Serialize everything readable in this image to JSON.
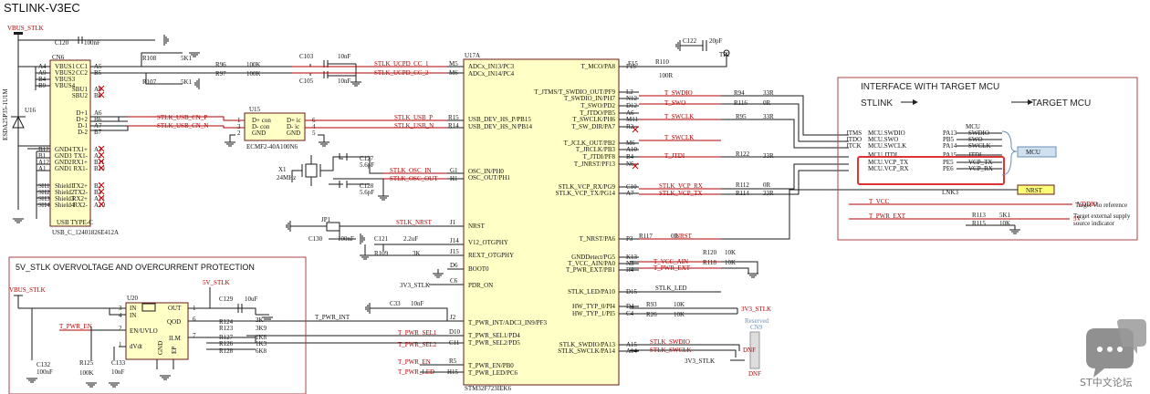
{
  "title": "STLINK-V3EC",
  "power": {
    "vbus_stlk": "VBUS_STLK",
    "v5_stlk": "5V_STLK",
    "v3v3_stlk": "3V3_STLK",
    "vddio": "VDDIO",
    "v5": "5V"
  },
  "usb_connector": {
    "ref": "CN6",
    "part": "USB_C_12401826E412A",
    "type": "USB TYPE-C",
    "left_pins": [
      {
        "num": "A4",
        "name": "VBUS1"
      },
      {
        "num": "A9",
        "name": "VBUS2"
      },
      {
        "num": "B4",
        "name": "VBUS3"
      },
      {
        "num": "B9",
        "name": "VBUS4"
      },
      {
        "num": "B12",
        "name": "GND4"
      },
      {
        "num": "B1",
        "name": "GND3"
      },
      {
        "num": "A12",
        "name": "GND2"
      },
      {
        "num": "A1",
        "name": "GND1"
      },
      {
        "num": "SH1",
        "name": "Shield1"
      },
      {
        "num": "SH2",
        "name": "Shield2"
      },
      {
        "num": "SH3",
        "name": "Shield3"
      },
      {
        "num": "SH4",
        "name": "Shield4"
      }
    ],
    "right_pins": [
      {
        "num": "A5",
        "name": "CC1"
      },
      {
        "num": "B5",
        "name": "CC2"
      },
      {
        "num": "A8",
        "name": "SBU1"
      },
      {
        "num": "B8",
        "name": "SBU2"
      },
      {
        "num": "A6",
        "name": "D+1"
      },
      {
        "num": "B6",
        "name": "D+2"
      },
      {
        "num": "A7",
        "name": "D-1"
      },
      {
        "num": "B7",
        "name": "D-2"
      },
      {
        "num": "A3",
        "name": "TX1+"
      },
      {
        "num": "A2",
        "name": "TX1-"
      },
      {
        "num": "B11",
        "name": "RX1+"
      },
      {
        "num": "B10",
        "name": "RX1-"
      },
      {
        "num": "B2",
        "name": "TX2+"
      },
      {
        "num": "B3",
        "name": "TX2-"
      },
      {
        "num": "A11",
        "name": "RX2+"
      },
      {
        "num": "A10",
        "name": "RX2-"
      }
    ]
  },
  "esd": {
    "ref": "U16",
    "part": "ESDA25P35-1U1M"
  },
  "usb_esd": {
    "ref": "U15",
    "part": "ECMF2-40A100N6",
    "pins": [
      "D+ con",
      "D- con",
      "GND",
      "D+ ic",
      "D- ic",
      "GND"
    ],
    "nums": [
      "1",
      "3",
      "2",
      "6",
      "4",
      "5"
    ]
  },
  "passives": {
    "c120": "C120",
    "c120v": "100nF",
    "r108": "R108",
    "r108v": "5K1",
    "r107": "R107",
    "r107v": "5K1",
    "r96": "R96",
    "r96v": "100K",
    "r97": "R97",
    "r97v": "100K",
    "c103": "C103",
    "c103v": "10nF",
    "c105": "C105",
    "c105v": "10nF",
    "c127": "C127",
    "c127v": "5.6pF",
    "c128": "C128",
    "c128v": "5.6pF",
    "x1": "X1",
    "x1v": "24MHz",
    "jp1": "JP1",
    "c130": "C130",
    "c130v": "100nF",
    "c121": "C121",
    "c121v": "2.2uF",
    "r109": "R109",
    "r109v": "3K",
    "c33": "C33",
    "c33v": "10nF",
    "c122": "C122",
    "c122v": "20pF",
    "tp2": "TP2",
    "r110": "R110",
    "r110v": "100R",
    "r94": "R94",
    "r94v": "33R",
    "r116": "R116",
    "r116v": "0R",
    "r95": "R95",
    "r95v": "33R",
    "r122": "R122",
    "r122v": "33R",
    "r112": "R112",
    "r112v": "0R",
    "r114": "R114",
    "r114v": "33R",
    "r117": "R117",
    "r117v": "0R",
    "r120": "R120",
    "r120v": "10K",
    "r118": "R118",
    "r118v": "10K",
    "r93": "R93",
    "r93v": "10K",
    "r26": "R26",
    "r26v": "10K",
    "r113": "R113",
    "r113v": "5K1",
    "r115": "R115",
    "r115v": "10K",
    "cn9": "CN9",
    "cn9_note": "Reserved",
    "dnf": "DNF"
  },
  "nets": {
    "ucpd_cc1": "STLK_UCPD_CC_1",
    "ucpd_cc2": "STLK_UCPD_CC_2",
    "usb_cn_p": "STLK_USB_CN_P",
    "usb_cn_n": "STLK_USB_CN_N",
    "usb_p": "STLK_USB_P",
    "usb_n": "STLK_USB_N",
    "osc_in": "STLK_OSC_IN",
    "osc_out": "STLK_OSC_OUT",
    "nrst": "STLK_NRST",
    "t_swdio": "T_SWDIO",
    "t_swo": "T_SWO",
    "t_swclk": "T_SWCLK",
    "t_jtdi": "T_JTDI",
    "t_vcp_rx": "T_VCP_RX",
    "t_vcp_tx": "T_VCP_TX",
    "stlk_vcp_rx": "STLK_VCP_RX",
    "stlk_vcp_tx": "STLK_VCP_TX",
    "nrst_out": "NRST",
    "t_vcc_ain": "T_VCC_AIN",
    "t_pwr_ext": "T_PWR_EXT",
    "t_vcc": "T_VCC",
    "stlk_led": "STLK_LED",
    "stlk_swdio": "STLK_SWDIO",
    "stlk_swclk": "STLK_SWCLK",
    "t_pwr_int": "T_PWR_INT",
    "t_pwr_en": "T_PWR_EN",
    "t_pwr_sel1": "T_PWR_SEL1",
    "t_pwr_sel2": "T_PWR_SEL2",
    "t_pwr_led": "T_PWR_LED"
  },
  "mcu": {
    "ref": "U17A",
    "part": "STM32F723IEK6",
    "left_pins": [
      {
        "num": "M5",
        "name": "ADCx_IN13/PC3"
      },
      {
        "num": "M6",
        "name": "ADCx_IN14/PC4"
      },
      {
        "num": "R15",
        "name": "USB_DEV_HS_P/PB15"
      },
      {
        "num": "R14",
        "name": "USB_DEV_HS_N/PB14"
      },
      {
        "num": "G1",
        "name": "OSC_IN/PH0"
      },
      {
        "num": "H1",
        "name": "OSC_OUT/PH1"
      },
      {
        "num": "J1",
        "name": "NRST"
      },
      {
        "num": "J14",
        "name": "V12_OTGPHY"
      },
      {
        "num": "J15",
        "name": "REXT_OTGPHY"
      },
      {
        "num": "D6",
        "name": "BOOT0"
      },
      {
        "num": "C6",
        "name": "PDR_ON"
      },
      {
        "num": "J2",
        "name": "T_PWR_INT/ADC3_IN9/PF3"
      },
      {
        "num": "D10",
        "name": "T_PWR_SEL1/PD4"
      },
      {
        "num": "C11",
        "name": "T_PWR_SEL2/PD5"
      },
      {
        "num": "R5",
        "name": "T_PWR_EN/PB0"
      },
      {
        "num": "H15",
        "name": "T_PWR_LED/PC6"
      }
    ],
    "right_pins": [
      {
        "num": "F15",
        "name": "T_MCO/PA8"
      },
      {
        "num": "L2",
        "name": "T_JTMS/T_SWDIO_OUT/PF9"
      },
      {
        "num": "N12",
        "name": "T_SWDIO_IN/PH7"
      },
      {
        "num": "D12",
        "name": "T_SWO/PD2"
      },
      {
        "num": "A6",
        "name": "T_JTDO/PB5"
      },
      {
        "num": "M11",
        "name": "T_SWCLK/PH6"
      },
      {
        "num": "R2",
        "name": "T_SW_DIR/PA7"
      },
      {
        "num": "M6",
        "name": "T_JCLK_OUT/PB2"
      },
      {
        "num": "A10",
        "name": "T_JRCLK/PB3"
      },
      {
        "num": "B4",
        "name": "T_JTDI/PF8"
      },
      {
        "num": "N6",
        "name": "T_JNRST/PF13"
      },
      {
        "num": "C10",
        "name": "STLK_VCP_RX/PG9"
      },
      {
        "num": "A7",
        "name": "STLK_VCP_TX/PG14"
      },
      {
        "num": "P3",
        "name": "T_NRST/PA6"
      },
      {
        "num": "K13",
        "name": "GNDDetect/PG5"
      },
      {
        "num": "N3",
        "name": "T_VCC_AIN/PA0"
      },
      {
        "num": "R4",
        "name": "T_PWR_EXT/PB1"
      },
      {
        "num": "D15",
        "name": "STLK_LED/PA10"
      },
      {
        "num": "D4",
        "name": "HW_TYP_0/PI4"
      },
      {
        "num": "C4",
        "name": "HW_TYP_1/PI5"
      },
      {
        "num": "A15",
        "name": "STLK_SWDIO/PA13"
      },
      {
        "num": "A14",
        "name": "STLK_SWCLK/PA14"
      }
    ]
  },
  "interface": {
    "title": "INTERFACE WITH TARGET MCU",
    "left_label": "STLINK",
    "right_label": "TARGET MCU",
    "mcu_header": "MCU",
    "mcu_box": "MCU",
    "rows": [
      {
        "a": "JTMS",
        "b": "MCU.SWDIO",
        "pin": "PA13",
        "sig": "SWDIO"
      },
      {
        "a": "JTDO",
        "b": "MCU.SWO",
        "pin": "PB5",
        "sig": "SWO"
      },
      {
        "a": "JTCK",
        "b": "MCU.SWCLK",
        "pin": "PA14",
        "sig": "SWCLK"
      },
      {
        "a": "",
        "b": "MCU.JTDI",
        "pin": "PA15",
        "sig": "JTDI"
      },
      {
        "a": "",
        "b": "MCU.VCP_TX",
        "pin": "PE5",
        "sig": "VCP_TX"
      },
      {
        "a": "",
        "b": "MCU.VCP_RX",
        "pin": "PE6",
        "sig": "VCP_RX"
      }
    ],
    "nrst_tag": "NRST",
    "lnk_label": "LNK3",
    "vio_ref": "Target Vio reference",
    "ext_supply": "Target external supply source indicator"
  },
  "protection": {
    "title": "5V_STLK OVERVOLTAGE AND OVERCURRENT PROTECTION",
    "ref": "U20",
    "pins_left": [
      {
        "num": "3",
        "name": "IN"
      },
      {
        "num": "4",
        "name": "IN"
      },
      {
        "num": "2",
        "name": "EN/UVLO"
      },
      {
        "num": "1",
        "name": "dVdt"
      }
    ],
    "pins_right": [
      {
        "num": "1",
        "name": "OUT"
      },
      {
        "num": "6",
        "name": "QOD"
      },
      {
        "num": "7",
        "name": "ILM"
      },
      {
        "num": "9",
        "name": "EP"
      },
      {
        "num": "5",
        "name": "GND"
      }
    ],
    "c129": "C129",
    "c129v": "10uF",
    "r124": "R124",
    "r124v": "3K",
    "r123": "R123",
    "r123v": "3K9",
    "r127": "R127",
    "r127v": "1K8",
    "r126": "R126",
    "r126v": "1K3",
    "r128": "R128",
    "r128v": "6K8",
    "c132": "C132",
    "c132v": "100nF",
    "r125": "R125",
    "r125v": "100K",
    "c133": "C133",
    "c133v": "10nF"
  },
  "watermark": {
    "text": "ST中文论坛"
  }
}
